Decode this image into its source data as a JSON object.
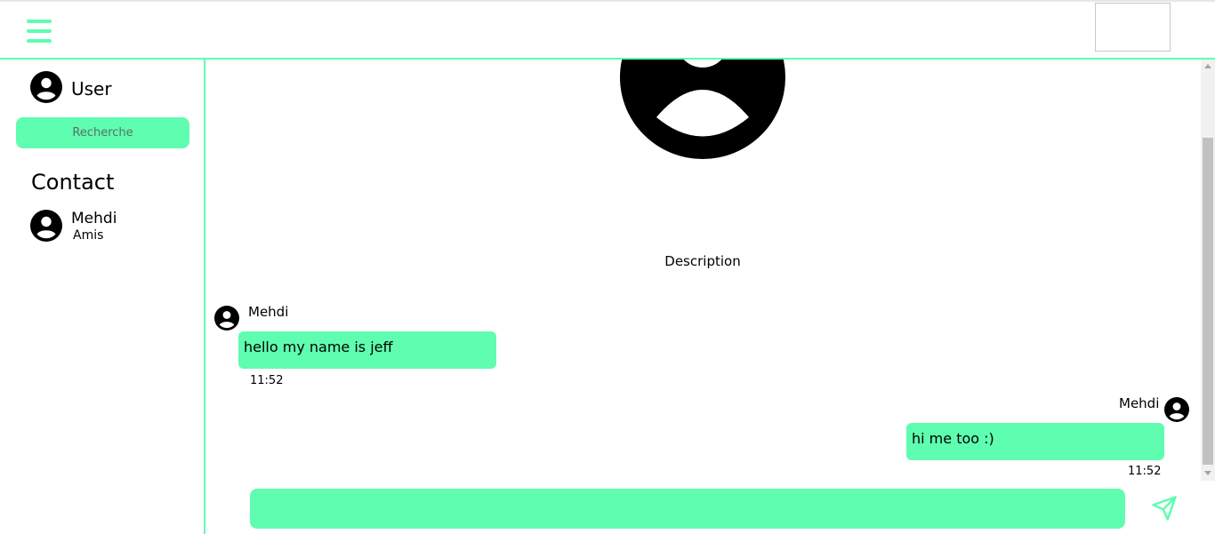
{
  "colors": {
    "accent": "#5ffdb0",
    "text": "#000000"
  },
  "header": {
    "menu_icon": "hamburger-icon"
  },
  "sidebar": {
    "user_label": "User",
    "search_placeholder": "Recherche",
    "contact_heading": "Contact",
    "contacts": [
      {
        "name": "Mehdi",
        "subtitle": "Amis"
      }
    ]
  },
  "chat": {
    "description": "Description",
    "messages": [
      {
        "sender": "Mehdi",
        "text": "hello my name is jeff",
        "time": "11:52",
        "side": "left"
      },
      {
        "sender": "Mehdi",
        "text": "hi me too :)",
        "time": "11:52",
        "side": "right"
      }
    ],
    "input_value": "",
    "send_icon": "send-icon"
  }
}
